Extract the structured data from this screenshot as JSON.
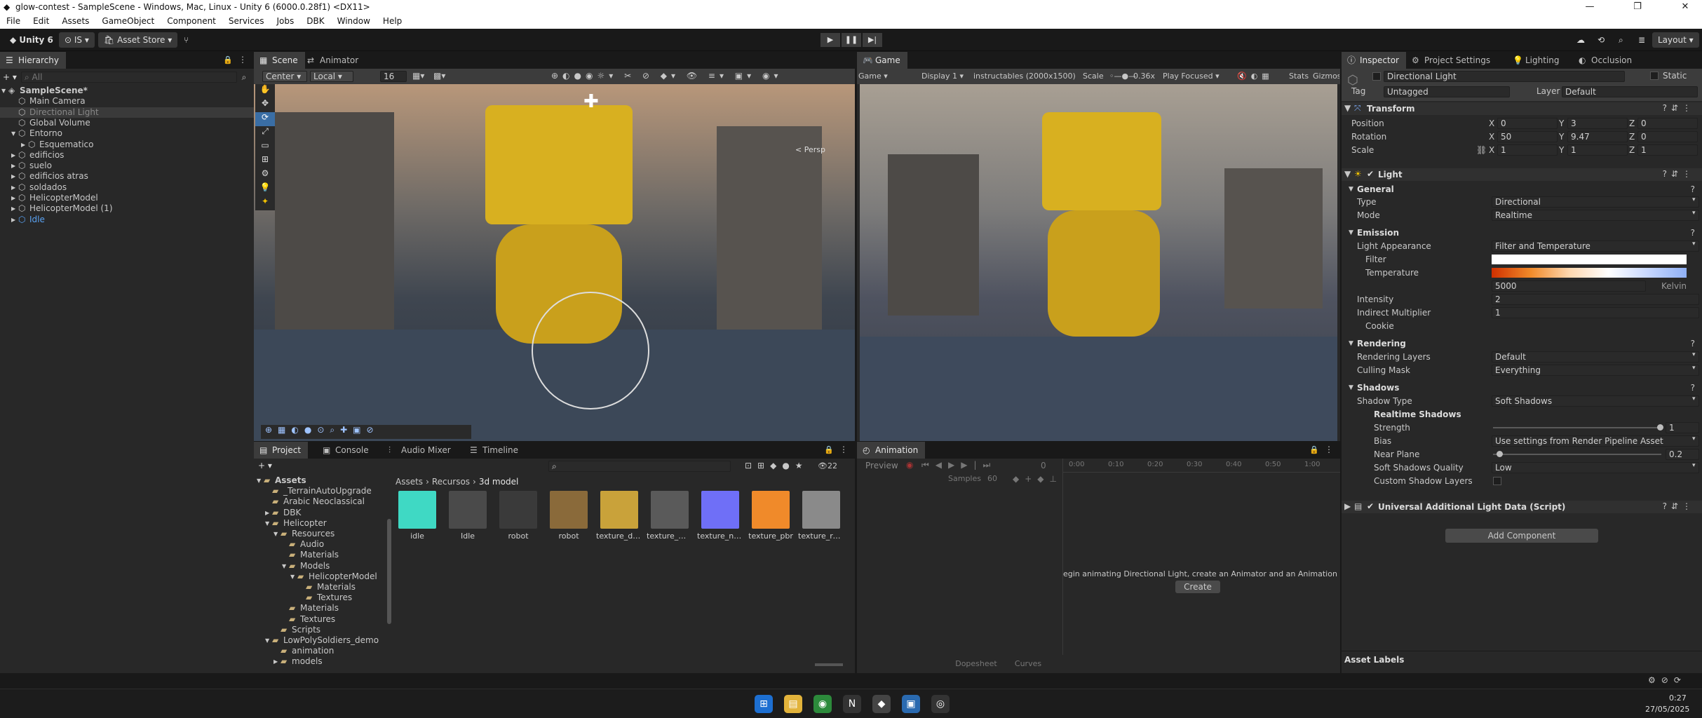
{
  "window": {
    "title": "glow-contest - SampleScene - Windows, Mac, Linux - Unity 6 (6000.0.28f1) <DX11>",
    "controls": [
      "—",
      "❐",
      "✕"
    ]
  },
  "menu": [
    "File",
    "Edit",
    "Assets",
    "GameObject",
    "Component",
    "Services",
    "Jobs",
    "DBK",
    "Window",
    "Help"
  ],
  "toolbar": {
    "product": "Unity 6",
    "account": "IS",
    "asset_store": "Asset Store",
    "layout": "Layout"
  },
  "hierarchy": {
    "tab": "Hierarchy",
    "search_placeholder": "All",
    "items": [
      {
        "label": "SampleScene*",
        "depth": 0,
        "arrow": "▼",
        "bold": true
      },
      {
        "label": "Main Camera",
        "depth": 1,
        "arrow": ""
      },
      {
        "label": "Directional Light",
        "depth": 1,
        "arrow": "",
        "selected": true
      },
      {
        "label": "Global Volume",
        "depth": 1,
        "arrow": ""
      },
      {
        "label": "Entorno",
        "depth": 1,
        "arrow": "▼"
      },
      {
        "label": "Esquematico",
        "depth": 2,
        "arrow": "▶"
      },
      {
        "label": "edificios",
        "depth": 1,
        "arrow": "▶"
      },
      {
        "label": "suelo",
        "depth": 1,
        "arrow": "▶"
      },
      {
        "label": "edificios atras",
        "depth": 1,
        "arrow": "▶"
      },
      {
        "label": "soldados",
        "depth": 1,
        "arrow": "▶"
      },
      {
        "label": "HelicopterModel",
        "depth": 1,
        "arrow": "▶"
      },
      {
        "label": "HelicopterModel (1)",
        "depth": 1,
        "arrow": "▶"
      },
      {
        "label": "Idle",
        "depth": 1,
        "arrow": "▶",
        "blue": true
      }
    ]
  },
  "scene": {
    "tabs": [
      "Scene",
      "Animator"
    ],
    "pivot": "Center",
    "space": "Local",
    "snap": "16",
    "persp": "< Persp"
  },
  "game": {
    "tab": "Game",
    "mode": "Game",
    "display": "Display 1",
    "resolution": "instructables (2000x1500)",
    "scale_label": "Scale",
    "scale_value": "0.36x",
    "play_mode": "Play Focused",
    "stats": "Stats",
    "gizmos": "Gizmos"
  },
  "project": {
    "tabs": [
      "Project",
      "Console",
      "Audio Mixer",
      "Timeline"
    ],
    "layer_count": "22",
    "breadcrumb": [
      "Assets",
      "Recursos",
      "3d model"
    ],
    "tree": [
      {
        "label": "Assets",
        "depth": 0,
        "arrow": "▼",
        "bold": true
      },
      {
        "label": "_TerrainAutoUpgrade",
        "depth": 1,
        "arrow": ""
      },
      {
        "label": "Arabic Neoclassical",
        "depth": 1,
        "arrow": ""
      },
      {
        "label": "DBK",
        "depth": 1,
        "arrow": "▶"
      },
      {
        "label": "Helicopter",
        "depth": 1,
        "arrow": "▼"
      },
      {
        "label": "Resources",
        "depth": 2,
        "arrow": "▼"
      },
      {
        "label": "Audio",
        "depth": 3,
        "arrow": ""
      },
      {
        "label": "Materials",
        "depth": 3,
        "arrow": ""
      },
      {
        "label": "Models",
        "depth": 3,
        "arrow": "▼"
      },
      {
        "label": "HelicopterModel",
        "depth": 4,
        "arrow": "▼"
      },
      {
        "label": "Materials",
        "depth": 5,
        "arrow": ""
      },
      {
        "label": "Textures",
        "depth": 5,
        "arrow": ""
      },
      {
        "label": "Materials",
        "depth": 3,
        "arrow": ""
      },
      {
        "label": "Textures",
        "depth": 3,
        "arrow": ""
      },
      {
        "label": "Scripts",
        "depth": 2,
        "arrow": ""
      },
      {
        "label": "LowPolySoldiers_demo",
        "depth": 1,
        "arrow": "▼"
      },
      {
        "label": "animation",
        "depth": 2,
        "arrow": ""
      },
      {
        "label": "models",
        "depth": 2,
        "arrow": "▶"
      }
    ],
    "assets": [
      {
        "label": "idle",
        "color": "#3fd9c4"
      },
      {
        "label": "Idle",
        "color": "#4a4a4a"
      },
      {
        "label": "robot",
        "color": "#3a3a3a"
      },
      {
        "label": "robot",
        "color": "#8a6a3a"
      },
      {
        "label": "texture_diff...",
        "color": "#c9a23a"
      },
      {
        "label": "texture_me...",
        "color": "#5a5a5a"
      },
      {
        "label": "texture_nor...",
        "color": "#6f6ff7"
      },
      {
        "label": "texture_pbr",
        "color": "#f08a2a"
      },
      {
        "label": "texture_rou...",
        "color": "#8a8a8a"
      }
    ]
  },
  "animation": {
    "tab": "Animation",
    "preview": "Preview",
    "frame": "0",
    "samples_label": "Samples",
    "samples": "60",
    "timeline_ticks": [
      "0:00",
      "0:10",
      "0:20",
      "0:30",
      "0:40",
      "0:50",
      "1:00"
    ],
    "message": "egin animating Directional Light, create an Animator and an Animation C",
    "create": "Create",
    "dopesheet": "Dopesheet",
    "curves": "Curves"
  },
  "inspector": {
    "tabs": [
      "Inspector",
      "Project Settings",
      "Lighting",
      "Occlusion"
    ],
    "object_name": "Directional Light",
    "static_label": "Static",
    "tag_label": "Tag",
    "tag": "Untagged",
    "layer_label": "Layer",
    "layer": "Default",
    "transform": {
      "title": "Transform",
      "position_label": "Position",
      "position": [
        "0",
        "3",
        "0"
      ],
      "rotation_label": "Rotation",
      "rotation": [
        "50",
        "9.47",
        "0"
      ],
      "scale_label": "Scale",
      "scale": [
        "1",
        "1",
        "1"
      ],
      "axes": [
        "X",
        "Y",
        "Z"
      ]
    },
    "light": {
      "title": "Light",
      "general": "General",
      "type_label": "Type",
      "type": "Directional",
      "mode_label": "Mode",
      "mode": "Realtime",
      "emission": "Emission",
      "appearance_label": "Light Appearance",
      "appearance": "Filter and Temperature",
      "filter_label": "Filter",
      "temperature_label": "Temperature",
      "temperature": "5000",
      "temperature_unit": "Kelvin",
      "intensity_label": "Intensity",
      "intensity": "2",
      "indirect_label": "Indirect Multiplier",
      "indirect": "1",
      "cookie_label": "Cookie",
      "rendering": "Rendering",
      "rendering_layers_label": "Rendering Layers",
      "rendering_layers": "Default",
      "culling_label": "Culling Mask",
      "culling": "Everything",
      "shadows": "Shadows",
      "shadow_type_label": "Shadow Type",
      "shadow_type": "Soft Shadows",
      "realtime_shadows": "Realtime Shadows",
      "strength_label": "Strength",
      "strength": "1",
      "strength_level": 1.0,
      "bias_label": "Bias",
      "bias": "Use settings from Render Pipeline Asset",
      "near_plane_label": "Near Plane",
      "near_plane": "0.2",
      "near_plane_level": 0.02,
      "soft_quality_label": "Soft Shadows Quality",
      "soft_quality": "Low",
      "custom_layers_label": "Custom Shadow Layers"
    },
    "urp": {
      "title": "Universal Additional Light Data (Script)"
    },
    "add_component": "Add Component",
    "asset_labels": "Asset Labels"
  },
  "taskbar": {
    "time": "0:27",
    "date": "27/05/2025"
  }
}
